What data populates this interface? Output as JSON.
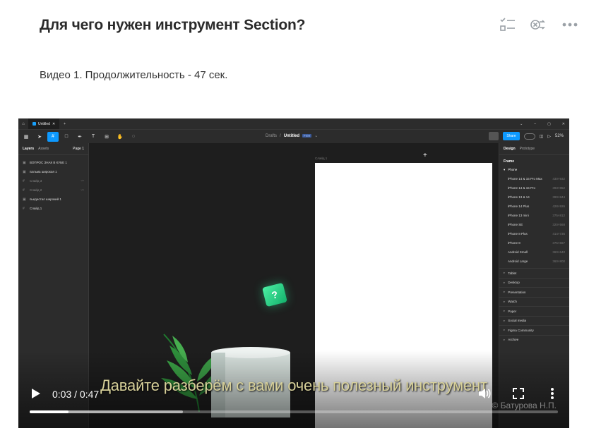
{
  "lesson": {
    "title": "Для чего нужен инструмент Section?",
    "video_caption": "Видео 1. Продолжительность - 47 сек."
  },
  "top_icons": [
    "checklist-icon",
    "shuffle-cross-icon",
    "more-icon"
  ],
  "player": {
    "time_display": "0:03 / 0:47",
    "subtitle": "Давайте разберём с вами очень полезный инструмент",
    "watermark": "© Батурова Н.П.",
    "progress_played": 0.073,
    "progress_buffered": 0.29
  },
  "figma": {
    "tab_title": "Untitled",
    "breadcrumb_drafts": "Drafts",
    "breadcrumb_sep": "/",
    "file_name": "Untitled",
    "plan_badge": "Free",
    "share_label": "Share",
    "zoom": "52%",
    "left_tabs": {
      "layers": "Layers",
      "assets": "Assets",
      "page": "Page 1"
    },
    "layers": [
      {
        "name": "ВОПРОС ЗНАК В КУБЕ 1",
        "glyph": "▣",
        "dim": false,
        "tail": ""
      },
      {
        "name": "пальма широкая 1",
        "glyph": "▣",
        "dim": false,
        "tail": ""
      },
      {
        "name": "Слайд 3",
        "glyph": "#",
        "dim": true,
        "tail": "〰"
      },
      {
        "name": "Слайд 2",
        "glyph": "#",
        "dim": true,
        "tail": "〰"
      },
      {
        "name": "пьедестал широкий 1",
        "glyph": "▣",
        "dim": false,
        "tail": ""
      },
      {
        "name": "Слайд 1",
        "glyph": "#",
        "dim": false,
        "tail": ""
      }
    ],
    "frame_label": "Слайд 1",
    "right_tabs": {
      "design": "Design",
      "prototype": "Prototype"
    },
    "frame_heading": "Frame",
    "phone_group": "Phone",
    "phone_items": [
      {
        "name": "iPhone 14 & 15 Pro Max",
        "size": "430×932"
      },
      {
        "name": "iPhone 14 & 15 Pro",
        "size": "393×852"
      },
      {
        "name": "iPhone 13 & 14",
        "size": "390×844"
      },
      {
        "name": "iPhone 14 Plus",
        "size": "428×926"
      },
      {
        "name": "iPhone 13 mini",
        "size": "375×812"
      },
      {
        "name": "iPhone SE",
        "size": "320×568"
      },
      {
        "name": "iPhone 8 Plus",
        "size": "414×736"
      },
      {
        "name": "iPhone 8",
        "size": "375×667"
      },
      {
        "name": "Android Small",
        "size": "360×640"
      },
      {
        "name": "Android Large",
        "size": "360×800"
      }
    ],
    "categories": [
      "Tablet",
      "Desktop",
      "Presentation",
      "Watch",
      "Paper",
      "Social media",
      "Figma Community",
      "Archive"
    ]
  },
  "colors": {
    "figma_blue": "#0d99ff",
    "subtitle": "#d8d19a",
    "cube_green": "#2ee696"
  }
}
